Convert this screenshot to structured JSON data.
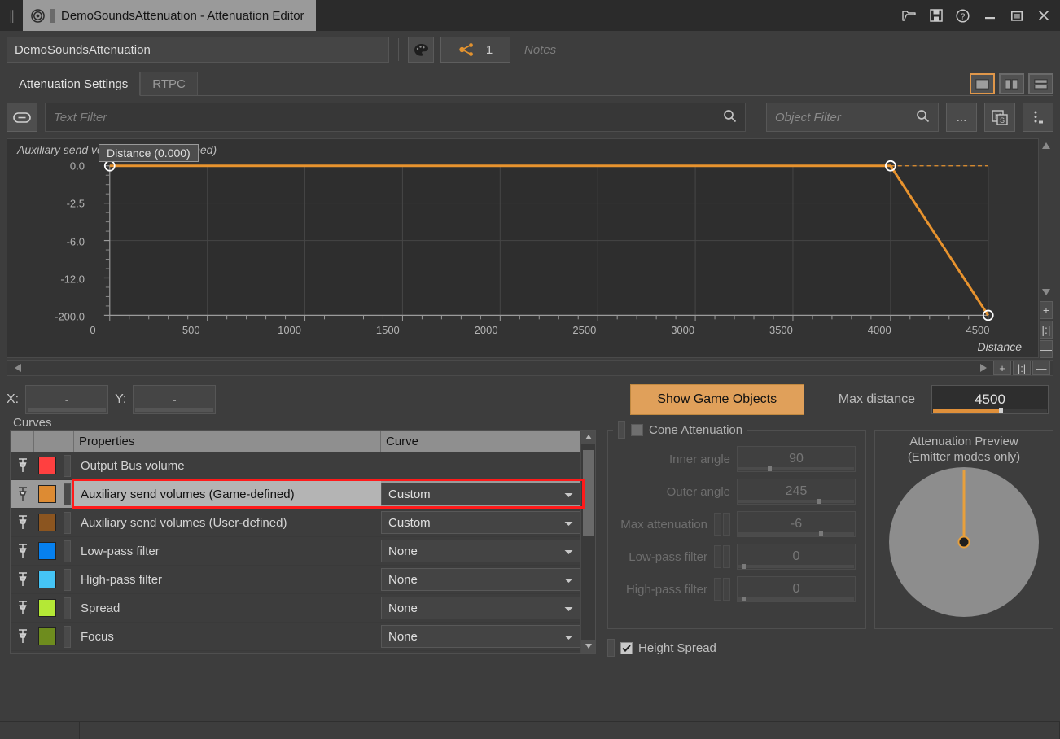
{
  "window": {
    "grip_icon": "drag-grip-icon",
    "tab_icon": "target-ring-icon",
    "title": "DemoSoundsAttenuation - Attenuation Editor",
    "buttons": [
      {
        "name": "open-folder-button",
        "icon": "folder-open-icon"
      },
      {
        "name": "save-button",
        "icon": "floppy-save-icon"
      },
      {
        "name": "help-button",
        "icon": "question-help-icon"
      },
      {
        "name": "minimize-button",
        "icon": "minimize-icon"
      },
      {
        "name": "maximize-button",
        "icon": "maximize-icon"
      },
      {
        "name": "close-button",
        "icon": "close-x-icon"
      }
    ]
  },
  "namerow": {
    "object_name": "DemoSoundsAttenuation",
    "color_icon": "palette-icon",
    "share_icon": "share-nodes-icon",
    "share_count": "1",
    "notes_placeholder": "Notes"
  },
  "tabs": [
    {
      "label": "Attenuation Settings",
      "active": true
    },
    {
      "label": "RTPC",
      "active": false
    }
  ],
  "layout_buttons": [
    {
      "name": "layout-single-button",
      "icon": "single-pane-icon",
      "selected": true
    },
    {
      "name": "layout-split-vertical-button",
      "icon": "split-vertical-icon",
      "selected": false
    },
    {
      "name": "layout-split-horizontal-button",
      "icon": "split-horizontal-icon",
      "selected": false
    }
  ],
  "filterbar": {
    "link_icon": "chain-link-icon",
    "text_filter_placeholder": "Text Filter",
    "search_icon": "search-icon",
    "object_filter_placeholder": "Object Filter",
    "ellipsis_label": "...",
    "mixer_icon": "ms-toggle-icon",
    "more_icon": "more-options-icon"
  },
  "graph": {
    "title": "Auxiliary send volumes (Game-defined)",
    "tooltip": "Distance (0.000)",
    "axis_name": "Distance",
    "curve_color": "#e8932e",
    "scroll_left_icon": "scroll-left-arrow-icon",
    "scroll_right_icon": "scroll-right-arrow-icon",
    "zoom_in_label": "+",
    "zoom_fit_label": "|:|",
    "zoom_out_label": "—"
  },
  "chart_data": {
    "type": "line",
    "title": "Auxiliary send volumes (Game-defined)",
    "xlabel": "Distance",
    "ylabel": "",
    "x": [
      0,
      4000,
      4500
    ],
    "y": [
      0.0,
      0.0,
      -200.0
    ],
    "points": [
      {
        "x": 0,
        "y": 0.0
      },
      {
        "x": 4000,
        "y": 0.0
      },
      {
        "x": 4500,
        "y": -200.0
      }
    ],
    "xticks": [
      0,
      500,
      1000,
      1500,
      2000,
      2500,
      3000,
      3500,
      4000,
      4500
    ],
    "xtick_labels": [
      "0",
      "500",
      "1000",
      "1500",
      "2000",
      "2500",
      "3000",
      "3500",
      "4000",
      "4500"
    ],
    "yticks": [
      0.0,
      -2.5,
      -6.0,
      -12.0,
      -200.0
    ],
    "ytick_labels": [
      "0.0",
      "-2.5",
      "-6.0",
      "-12.0",
      "-200.0"
    ],
    "xlim": [
      0,
      4500
    ],
    "grid": true,
    "legend": "none",
    "series_color": "#e8932e"
  },
  "xyrow": {
    "x_label": "X:",
    "x_value": "-",
    "y_label": "Y:",
    "y_value": "-",
    "show_game_objects_label": "Show Game Objects",
    "max_distance_label": "Max distance",
    "max_distance_value": "4500"
  },
  "curves": {
    "legend": "Curves",
    "headers": [
      "",
      "",
      "",
      "Properties",
      "Curve"
    ],
    "rows": [
      {
        "property": "Output Bus volume",
        "curve": "",
        "color": "#ff4040",
        "pin": "pin-icon",
        "selected": false
      },
      {
        "property": "Auxiliary send volumes (Game-defined)",
        "curve": "Custom",
        "color": "#dd8b33",
        "pin": "pin-icon",
        "selected": true
      },
      {
        "property": "Auxiliary send volumes (User-defined)",
        "curve": "Custom",
        "color": "#8b5520",
        "pin": "pin-icon",
        "selected": false
      },
      {
        "property": "Low-pass filter",
        "curve": "None",
        "color": "#0680ef",
        "pin": "pin-icon",
        "selected": false
      },
      {
        "property": "High-pass filter",
        "curve": "None",
        "color": "#45c4f5",
        "pin": "pin-icon",
        "selected": false
      },
      {
        "property": "Spread",
        "curve": "None",
        "color": "#b4e836",
        "pin": "pin-icon",
        "selected": false
      },
      {
        "property": "Focus",
        "curve": "None",
        "color": "#6e8c1e",
        "pin": "pin-icon",
        "selected": false
      }
    ]
  },
  "cone": {
    "title": "Cone Attenuation",
    "checked": false,
    "rows": [
      {
        "label": "Inner angle",
        "value": "90",
        "slider_pct": 25,
        "has_grips": false
      },
      {
        "label": "Outer angle",
        "value": "245",
        "slider_pct": 68,
        "has_grips": false
      },
      {
        "label": "Max attenuation",
        "value": "-6",
        "slider_pct": 70,
        "has_grips": true
      },
      {
        "label": "Low-pass filter",
        "value": "0",
        "slider_pct": 3,
        "has_grips": true
      },
      {
        "label": "High-pass filter",
        "value": "0",
        "slider_pct": 3,
        "has_grips": true
      }
    ],
    "height_spread_label": "Height Spread",
    "height_spread_checked": true
  },
  "preview": {
    "title_line1": "Attenuation Preview",
    "title_line2": "(Emitter modes only)",
    "circle_color": "#8d8d8d",
    "ray_color": "#e8a03c"
  }
}
